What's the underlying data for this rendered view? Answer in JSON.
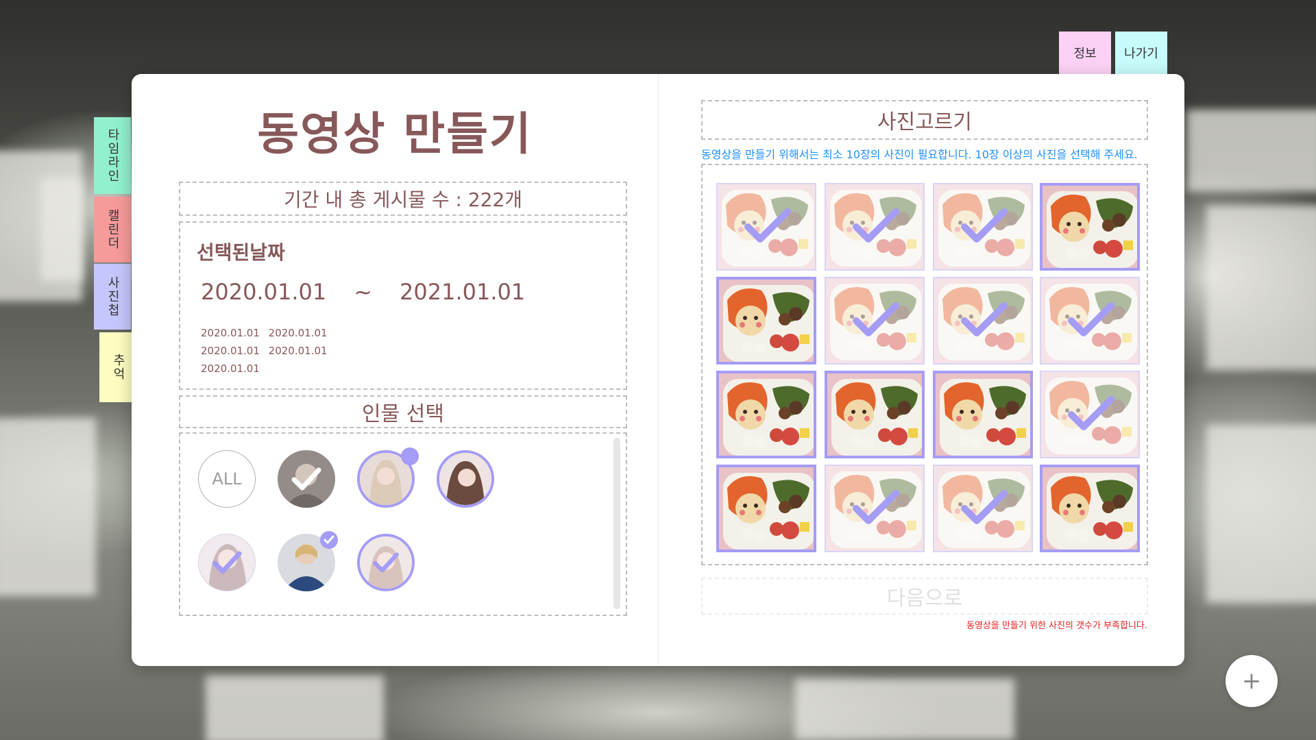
{
  "header": {
    "info_label": "정보",
    "exit_label": "나가기"
  },
  "sidebar": {
    "items": [
      {
        "label": "타임라인",
        "color": "#92f0cc"
      },
      {
        "label": "캘린더",
        "color": "#f69a9a"
      },
      {
        "label": "사진첩",
        "color": "#c5c6fb"
      },
      {
        "label": "추억",
        "color": "#fdfcc1"
      }
    ]
  },
  "left": {
    "title": "동영상 만들기",
    "total_posts": "기간 내 총 게시물 수 : 222개",
    "selected_date_label": "선택된날짜",
    "range_start": "2020.01.01",
    "range_sep": "~",
    "range_end": "2021.01.01",
    "dates": [
      "2020.01.01",
      "2020.01.01",
      "2020.01.01",
      "2020.01.01",
      "2020.01.01"
    ],
    "people_label": "인물 선택",
    "all_label": "ALL",
    "people": [
      {
        "name": "person-1",
        "state": "dimmed-checked"
      },
      {
        "name": "person-2",
        "state": "selected-badge"
      },
      {
        "name": "person-3",
        "state": "selected"
      },
      {
        "name": "person-4",
        "state": "dimmed-checked"
      },
      {
        "name": "person-5",
        "state": "badge-checked"
      },
      {
        "name": "person-6",
        "state": "selected-checked"
      }
    ]
  },
  "right": {
    "title": "사진고르기",
    "notice": "동영상을 만들기 위해서는 최소 10장의 사진이 필요합니다. 10장 이상의 사진을 선택해 주세요.",
    "photos": [
      "dim",
      "dim",
      "dim",
      "sel",
      "sel",
      "dim",
      "dim",
      "dim",
      "sel",
      "sel",
      "sel",
      "dim",
      "sel",
      "dim",
      "dim",
      "sel"
    ],
    "next_label": "다음으로",
    "warning": "동영상을 만들기 위한 사진의 갯수가 부족합니다."
  },
  "fab": {
    "label": "+"
  },
  "colors": {
    "accent": "#a59cf5",
    "title": "#87585a",
    "notice": "#1e90ff",
    "warning": "#e02020"
  }
}
